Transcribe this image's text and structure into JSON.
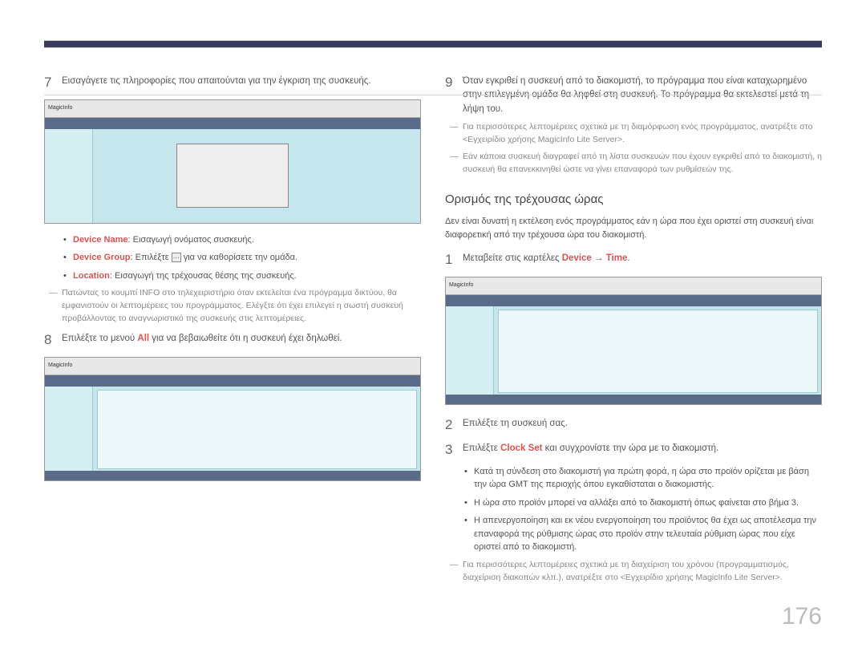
{
  "left": {
    "step7": {
      "num": "7",
      "text": "Εισαγάγετε τις πληροφορίες που απαιτούνται για την έγκριση της συσκευής."
    },
    "bullets": {
      "b1": {
        "label": "Device Name",
        "text": ": Εισαγωγή ονόματος συσκευής."
      },
      "b2": {
        "label": "Device Group",
        "pre": "Επιλέξτε",
        "post": "για να καθορίσετε την ομάδα."
      },
      "b3": {
        "label": "Location",
        "text": ": Εισαγωγή της τρέχουσας θέσης της συσκευής."
      }
    },
    "note7": "Πατώντας το κουμπί INFO στο τηλεχειριστήριο όταν εκτελείται ένα πρόγραμμα δικτύου, θα εμφανιστούν οι λεπτομέρειες του προγράμματος. Ελέγξτε ότι έχει επιλεγεί η σωστή συσκευή προβάλλοντας το αναγνωριστικό της συσκευής στις λεπτομέρειες.",
    "step8": {
      "num": "8",
      "pre": "Επιλέξτε το μενού ",
      "red": "All",
      "post": " για να βεβαιωθείτε ότι η συσκευή έχει δηλωθεί."
    }
  },
  "right": {
    "step9": {
      "num": "9",
      "text": "Όταν εγκριθεί η συσκευή από το διακομιστή, το πρόγραμμα που είναι καταχωρημένο στην επιλεγμένη ομάδα θα ληφθεί στη συσκευή. Το πρόγραμμα θα εκτελεστεί μετά τη λήψη του."
    },
    "note9a": "Για περισσότερες λεπτομέρειες σχετικά με τη διαμόρφωση ενός προγράμματος, ανατρέξτε στο <Εγχειρίδιο χρήσης MagicInfo Lite Server>.",
    "note9b": "Εάν κάποια συσκευή διαγραφεί από τη λίστα συσκευών που έχουν εγκριθεί από το διακομιστή, η συσκευή θα επανεκκινηθεί ώστε να γίνει επαναφορά των ρυθμίσεών της.",
    "section_title": "Ορισμός της τρέχουσας ώρας",
    "section_sub": "Δεν είναι δυνατή η εκτέλεση ενός προγράμματος εάν η ώρα που έχει οριστεί στη συσκευή είναι διαφορετική από την τρέχουσα ώρα του διακομιστή.",
    "t1": {
      "num": "1",
      "pre": "Μεταβείτε στις καρτέλες ",
      "red1": "Device",
      "arrow": " → ",
      "red2": "Time",
      "post": "."
    },
    "t2": {
      "num": "2",
      "text": "Επιλέξτε τη συσκευή σας."
    },
    "t3": {
      "num": "3",
      "pre": "Επιλέξτε ",
      "red": "Clock Set",
      "post": " και συγχρονίστε την ώρα με το διακομιστή."
    },
    "tbullets": {
      "b1": "Κατά τη σύνδεση στο διακομιστή για πρώτη φορά, η ώρα στο προϊόν ορίζεται με βάση την ώρα GMT της περιοχής όπου εγκαθίσταται ο διακομιστής.",
      "b2": "Η ώρα στο προϊόν μπορεί να αλλάξει από το διακομιστή όπως φαίνεται στο βήμα 3.",
      "b3": "Η απενεργοποίηση και εκ νέου ενεργοποίηση του προϊόντος θα έχει ως αποτέλεσμα την επαναφορά της ρύθμισης ώρας στο προϊόν στην τελευταία ρύθμιση ώρας που είχε οριστεί από το διακομιστή."
    },
    "tnote": "Για περισσότερες λεπτομέρειες σχετικά με τη διαχείριση του χρόνου (προγραμματισμός, διαχείριση διακοπών κλπ.), ανατρέξτε στο <Εγχειρίδιο χρήσης MagicInfo Lite Server>."
  },
  "page_number": "176"
}
